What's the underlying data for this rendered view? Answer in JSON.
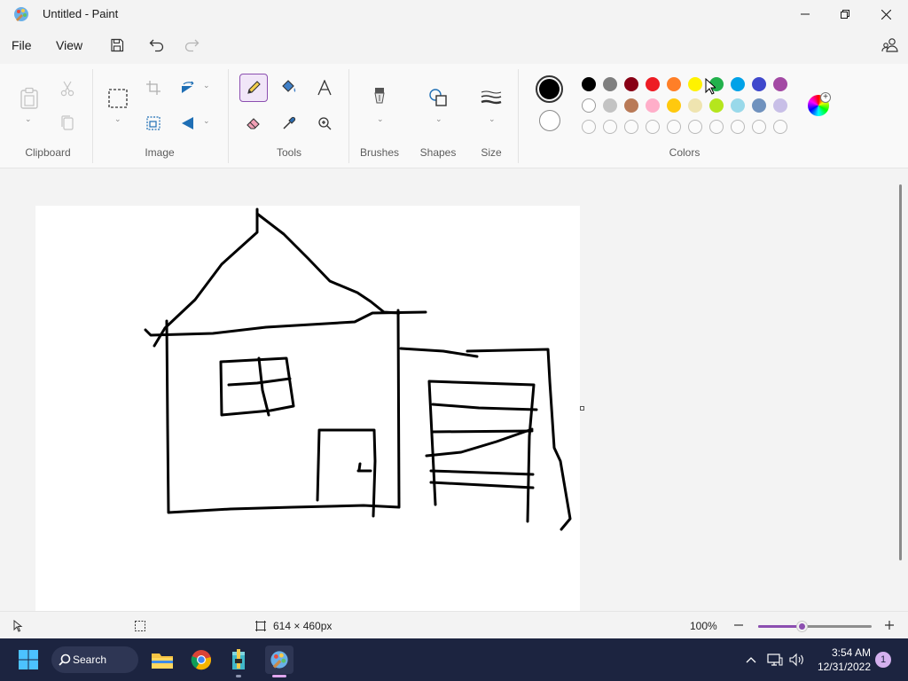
{
  "window": {
    "title": "Untitled - Paint",
    "controls": [
      "minimize",
      "restore",
      "close"
    ]
  },
  "menu": {
    "file_label": "File",
    "view_label": "View",
    "icons": [
      "save-icon",
      "undo-icon",
      "redo-icon",
      "account-icon"
    ]
  },
  "ribbon": {
    "groups": {
      "clipboard": "Clipboard",
      "image": "Image",
      "tools": "Tools",
      "brushes": "Brushes",
      "shapes": "Shapes",
      "size": "Size",
      "colors": "Colors"
    },
    "active_tool": "pencil",
    "primary_color": "#000000",
    "secondary_color": "#ffffff",
    "palette_row1": [
      "#000000",
      "#7f7f7f",
      "#880015",
      "#ed1c24",
      "#ff7f27",
      "#fff200",
      "#22b14c",
      "#00a2e8",
      "#3f48cc",
      "#a349a4"
    ],
    "palette_row2": [
      "#ffffff",
      "#c3c3c3",
      "#b97a57",
      "#ffaec9",
      "#ffc90e",
      "#efe4b0",
      "#b5e61d",
      "#99d9ea",
      "#7092be",
      "#c8bfe7"
    ],
    "palette_row3_empty_count": 10
  },
  "status": {
    "canvas_size": "614 × 460px",
    "zoom": "100%",
    "zoom_level_fraction": 0.39
  },
  "taskbar": {
    "search_label": "Search",
    "time": "3:54 AM",
    "date": "12/31/2022",
    "notification_count": "1",
    "apps": [
      "start-icon",
      "file-explorer-icon",
      "chrome-icon",
      "archive-app-icon",
      "paint-icon"
    ]
  }
}
